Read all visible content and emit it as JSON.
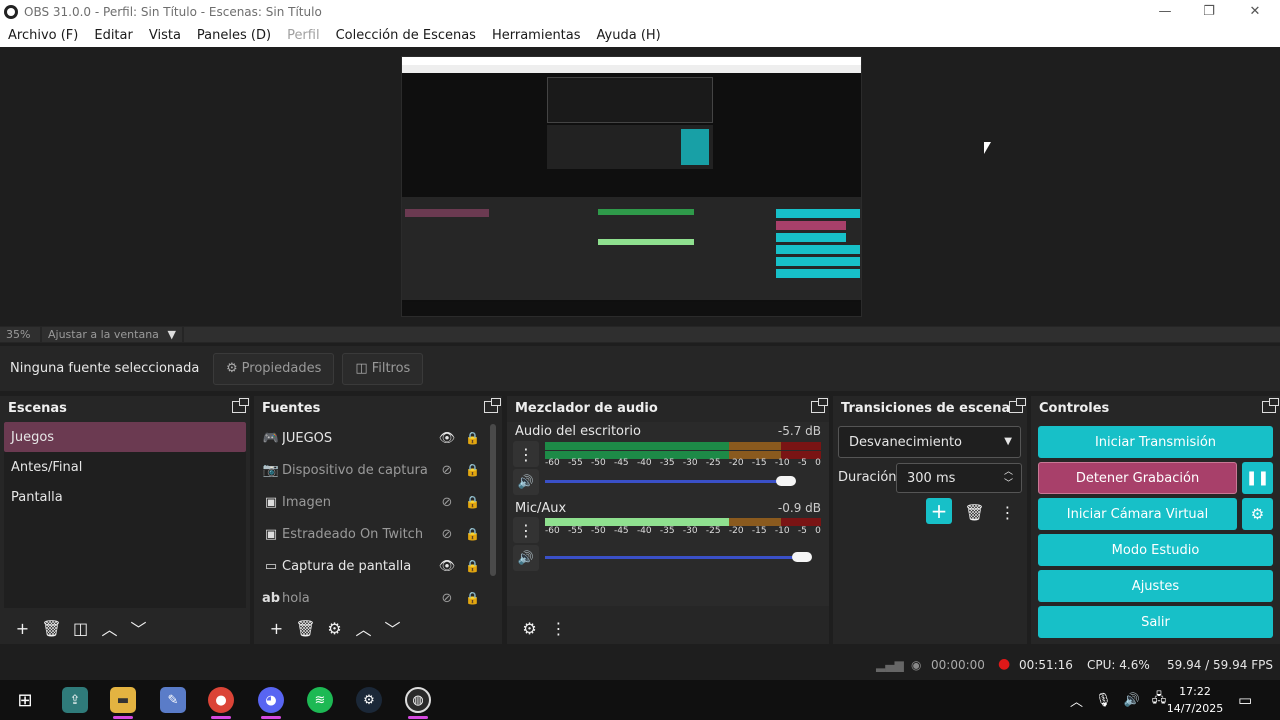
{
  "window": {
    "title": "OBS 31.0.0 - Perfil: Sin Título - Escenas: Sin Título",
    "minimize": "—",
    "maximize": "❐",
    "close": "✕"
  },
  "menu": [
    "Archivo (F)",
    "Editar",
    "Vista",
    "Paneles (D)",
    "Perfil",
    "Colección de Escenas",
    "Herramientas",
    "Ayuda (H)"
  ],
  "zoom": {
    "value": "35%",
    "fit_label": "Ajustar a la ventana"
  },
  "source_bar": {
    "none_selected": "Ninguna fuente seleccionada",
    "properties": "Propiedades",
    "filters": "Filtros"
  },
  "scenes": {
    "title": "Escenas",
    "items": [
      "Juegos",
      "Antes/Final",
      "Pantalla"
    ],
    "selected": 0
  },
  "sources": {
    "title": "Fuentes",
    "items": [
      {
        "name": "JUEGOS",
        "icon": "gamepad-icon",
        "visible": true
      },
      {
        "name": "Dispositivo de captura de vídeo",
        "icon": "camera-icon",
        "visible": false
      },
      {
        "name": "Imagen",
        "icon": "image-icon",
        "visible": false
      },
      {
        "name": "Estradeado On Twitch",
        "icon": "image-icon",
        "visible": false
      },
      {
        "name": "Captura de pantalla",
        "icon": "monitor-icon",
        "visible": true
      },
      {
        "name": "hola",
        "icon": "text-icon",
        "visible": false
      }
    ]
  },
  "mixer": {
    "title": "Mezclador de audio",
    "ticks": [
      "-60",
      "-55",
      "-50",
      "-45",
      "-40",
      "-35",
      "-30",
      "-25",
      "-20",
      "-15",
      "-10",
      "-5",
      "0"
    ],
    "channels": [
      {
        "name": "Audio del escritorio",
        "db": "-5.7 dB",
        "volume": 0.93
      },
      {
        "name": "Mic/Aux",
        "db": "-0.9 dB",
        "volume": 0.99
      }
    ]
  },
  "transitions": {
    "title": "Transiciones de escena",
    "selected": "Desvanecimiento",
    "duration_label": "Duración",
    "duration_value": "300 ms"
  },
  "controls": {
    "title": "Controles",
    "start_stream": "Iniciar Transmisión",
    "stop_recording": "Detener Grabación",
    "start_virtual_cam": "Iniciar Cámara Virtual",
    "studio_mode": "Modo Estudio",
    "settings": "Ajustes",
    "exit": "Salir"
  },
  "status": {
    "stream_time": "00:00:00",
    "rec_time": "00:51:16",
    "cpu": "CPU: 4.6%",
    "fps": "59.94 / 59.94 FPS"
  },
  "clock": {
    "time": "17:22",
    "date": "14/7/2025"
  },
  "colors": {
    "accent": "#17c0c8",
    "record": "#a8406a",
    "selected_scene": "#6b3a51"
  }
}
